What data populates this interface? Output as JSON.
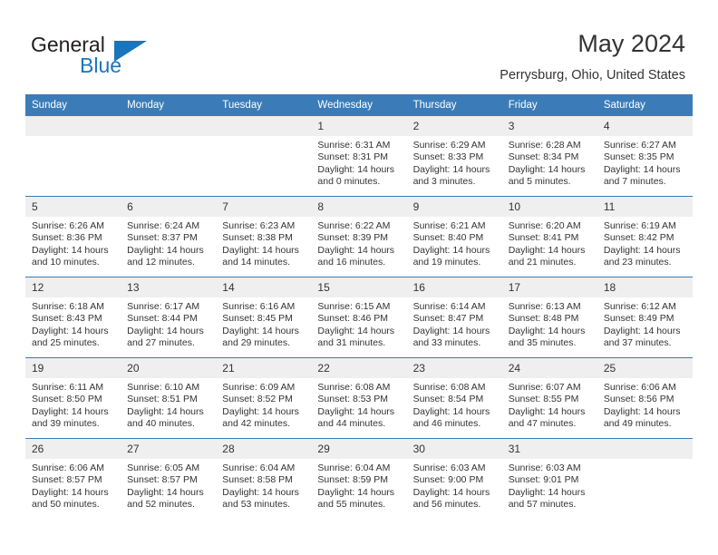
{
  "brand": {
    "name_part1": "General",
    "name_part2": "Blue",
    "logo_icon": "triangle-logo-icon"
  },
  "header": {
    "title": "May 2024",
    "subtitle": "Perrysburg, Ohio, United States"
  },
  "colors": {
    "header_blue": "#3b7cb8",
    "brand_blue": "#1b75bb",
    "daynum_band": "#efefef",
    "text": "#333333"
  },
  "weekday_headers": [
    "Sunday",
    "Monday",
    "Tuesday",
    "Wednesday",
    "Thursday",
    "Friday",
    "Saturday"
  ],
  "labels": {
    "sunrise_prefix": "Sunrise:",
    "sunset_prefix": "Sunset:",
    "daylight_prefix": "Daylight:"
  },
  "weeks": [
    [
      {
        "day": "",
        "empty": true
      },
      {
        "day": "",
        "empty": true
      },
      {
        "day": "",
        "empty": true
      },
      {
        "day": "1",
        "sunrise": "Sunrise: 6:31 AM",
        "sunset": "Sunset: 8:31 PM",
        "daylight": "Daylight: 14 hours and 0 minutes."
      },
      {
        "day": "2",
        "sunrise": "Sunrise: 6:29 AM",
        "sunset": "Sunset: 8:33 PM",
        "daylight": "Daylight: 14 hours and 3 minutes."
      },
      {
        "day": "3",
        "sunrise": "Sunrise: 6:28 AM",
        "sunset": "Sunset: 8:34 PM",
        "daylight": "Daylight: 14 hours and 5 minutes."
      },
      {
        "day": "4",
        "sunrise": "Sunrise: 6:27 AM",
        "sunset": "Sunset: 8:35 PM",
        "daylight": "Daylight: 14 hours and 7 minutes."
      }
    ],
    [
      {
        "day": "5",
        "sunrise": "Sunrise: 6:26 AM",
        "sunset": "Sunset: 8:36 PM",
        "daylight": "Daylight: 14 hours and 10 minutes."
      },
      {
        "day": "6",
        "sunrise": "Sunrise: 6:24 AM",
        "sunset": "Sunset: 8:37 PM",
        "daylight": "Daylight: 14 hours and 12 minutes."
      },
      {
        "day": "7",
        "sunrise": "Sunrise: 6:23 AM",
        "sunset": "Sunset: 8:38 PM",
        "daylight": "Daylight: 14 hours and 14 minutes."
      },
      {
        "day": "8",
        "sunrise": "Sunrise: 6:22 AM",
        "sunset": "Sunset: 8:39 PM",
        "daylight": "Daylight: 14 hours and 16 minutes."
      },
      {
        "day": "9",
        "sunrise": "Sunrise: 6:21 AM",
        "sunset": "Sunset: 8:40 PM",
        "daylight": "Daylight: 14 hours and 19 minutes."
      },
      {
        "day": "10",
        "sunrise": "Sunrise: 6:20 AM",
        "sunset": "Sunset: 8:41 PM",
        "daylight": "Daylight: 14 hours and 21 minutes."
      },
      {
        "day": "11",
        "sunrise": "Sunrise: 6:19 AM",
        "sunset": "Sunset: 8:42 PM",
        "daylight": "Daylight: 14 hours and 23 minutes."
      }
    ],
    [
      {
        "day": "12",
        "sunrise": "Sunrise: 6:18 AM",
        "sunset": "Sunset: 8:43 PM",
        "daylight": "Daylight: 14 hours and 25 minutes."
      },
      {
        "day": "13",
        "sunrise": "Sunrise: 6:17 AM",
        "sunset": "Sunset: 8:44 PM",
        "daylight": "Daylight: 14 hours and 27 minutes."
      },
      {
        "day": "14",
        "sunrise": "Sunrise: 6:16 AM",
        "sunset": "Sunset: 8:45 PM",
        "daylight": "Daylight: 14 hours and 29 minutes."
      },
      {
        "day": "15",
        "sunrise": "Sunrise: 6:15 AM",
        "sunset": "Sunset: 8:46 PM",
        "daylight": "Daylight: 14 hours and 31 minutes."
      },
      {
        "day": "16",
        "sunrise": "Sunrise: 6:14 AM",
        "sunset": "Sunset: 8:47 PM",
        "daylight": "Daylight: 14 hours and 33 minutes."
      },
      {
        "day": "17",
        "sunrise": "Sunrise: 6:13 AM",
        "sunset": "Sunset: 8:48 PM",
        "daylight": "Daylight: 14 hours and 35 minutes."
      },
      {
        "day": "18",
        "sunrise": "Sunrise: 6:12 AM",
        "sunset": "Sunset: 8:49 PM",
        "daylight": "Daylight: 14 hours and 37 minutes."
      }
    ],
    [
      {
        "day": "19",
        "sunrise": "Sunrise: 6:11 AM",
        "sunset": "Sunset: 8:50 PM",
        "daylight": "Daylight: 14 hours and 39 minutes."
      },
      {
        "day": "20",
        "sunrise": "Sunrise: 6:10 AM",
        "sunset": "Sunset: 8:51 PM",
        "daylight": "Daylight: 14 hours and 40 minutes."
      },
      {
        "day": "21",
        "sunrise": "Sunrise: 6:09 AM",
        "sunset": "Sunset: 8:52 PM",
        "daylight": "Daylight: 14 hours and 42 minutes."
      },
      {
        "day": "22",
        "sunrise": "Sunrise: 6:08 AM",
        "sunset": "Sunset: 8:53 PM",
        "daylight": "Daylight: 14 hours and 44 minutes."
      },
      {
        "day": "23",
        "sunrise": "Sunrise: 6:08 AM",
        "sunset": "Sunset: 8:54 PM",
        "daylight": "Daylight: 14 hours and 46 minutes."
      },
      {
        "day": "24",
        "sunrise": "Sunrise: 6:07 AM",
        "sunset": "Sunset: 8:55 PM",
        "daylight": "Daylight: 14 hours and 47 minutes."
      },
      {
        "day": "25",
        "sunrise": "Sunrise: 6:06 AM",
        "sunset": "Sunset: 8:56 PM",
        "daylight": "Daylight: 14 hours and 49 minutes."
      }
    ],
    [
      {
        "day": "26",
        "sunrise": "Sunrise: 6:06 AM",
        "sunset": "Sunset: 8:57 PM",
        "daylight": "Daylight: 14 hours and 50 minutes."
      },
      {
        "day": "27",
        "sunrise": "Sunrise: 6:05 AM",
        "sunset": "Sunset: 8:57 PM",
        "daylight": "Daylight: 14 hours and 52 minutes."
      },
      {
        "day": "28",
        "sunrise": "Sunrise: 6:04 AM",
        "sunset": "Sunset: 8:58 PM",
        "daylight": "Daylight: 14 hours and 53 minutes."
      },
      {
        "day": "29",
        "sunrise": "Sunrise: 6:04 AM",
        "sunset": "Sunset: 8:59 PM",
        "daylight": "Daylight: 14 hours and 55 minutes."
      },
      {
        "day": "30",
        "sunrise": "Sunrise: 6:03 AM",
        "sunset": "Sunset: 9:00 PM",
        "daylight": "Daylight: 14 hours and 56 minutes."
      },
      {
        "day": "31",
        "sunrise": "Sunrise: 6:03 AM",
        "sunset": "Sunset: 9:01 PM",
        "daylight": "Daylight: 14 hours and 57 minutes."
      },
      {
        "day": "",
        "empty": true
      }
    ]
  ]
}
